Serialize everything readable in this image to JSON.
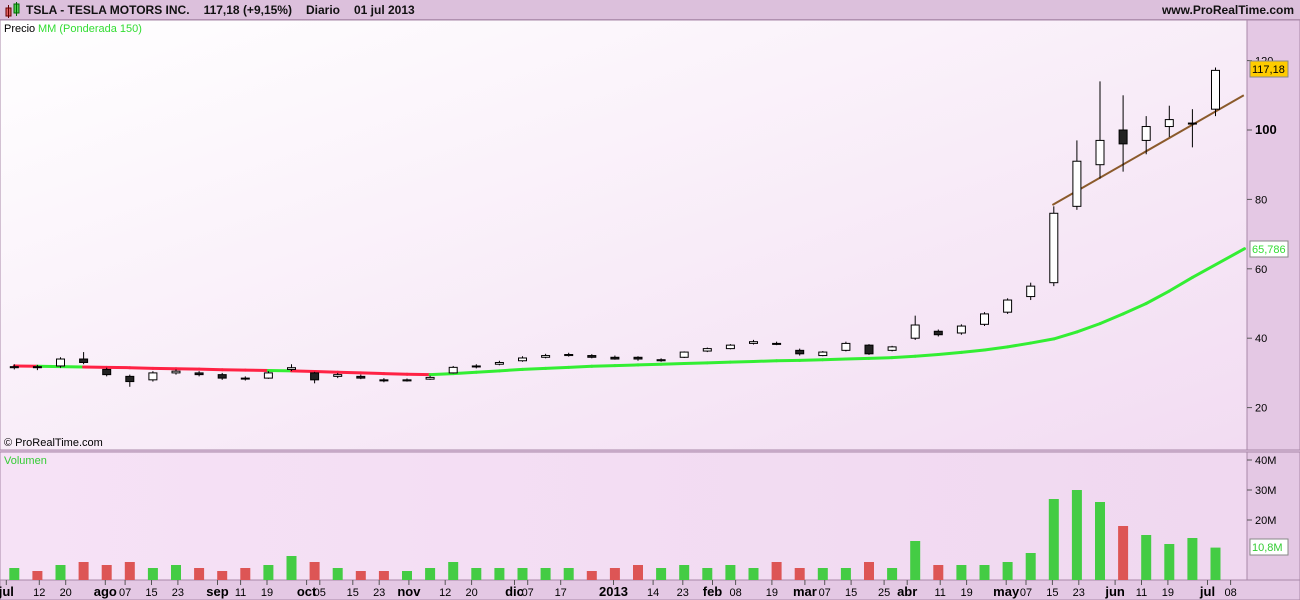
{
  "header": {
    "symbol": "TSLA - TESLA MOTORS INC.",
    "price": "117,18 (+9,15%)",
    "period": "Diario",
    "date": "01 jul 2013",
    "site": "www.ProRealTime.com"
  },
  "legend": {
    "price": "Precio",
    "ma": "MM (Ponderada 150)",
    "volume": "Volumen"
  },
  "copyright": "© ProRealTime.com",
  "colors": {
    "up": "#44cc44",
    "down": "#dd5555",
    "ma_above": "#33ee33",
    "ma_below": "#ff2244",
    "trendline": "#8b5a2b",
    "last_price_badge": "#ffcc00"
  },
  "chart_data": {
    "type": "candlestick",
    "price_axis": {
      "ticks": [
        "120",
        "100",
        "80",
        "60",
        "40",
        "20"
      ],
      "range": [
        15,
        130
      ]
    },
    "volume_axis": {
      "ticks": [
        "40M",
        "30M",
        "20M"
      ],
      "range": [
        0,
        40
      ]
    },
    "last_price": "117,18",
    "last_ma": "65,786",
    "last_volume": "10,8M",
    "x_ticks": [
      [
        "jul",
        "2012-07-02",
        1
      ],
      [
        "12",
        "2012-07-12",
        0
      ],
      [
        "20",
        "2012-07-20",
        0
      ],
      [
        "ago",
        "2012-08-01",
        1
      ],
      [
        "07",
        "2012-08-07",
        0
      ],
      [
        "15",
        "2012-08-15",
        0
      ],
      [
        "23",
        "2012-08-23",
        0
      ],
      [
        "sep",
        "2012-09-04",
        1
      ],
      [
        "11",
        "2012-09-11",
        0
      ],
      [
        "19",
        "2012-09-19",
        0
      ],
      [
        "oct",
        "2012-10-01",
        1
      ],
      [
        "05",
        "2012-10-05",
        0
      ],
      [
        "15",
        "2012-10-15",
        0
      ],
      [
        "23",
        "2012-10-23",
        0
      ],
      [
        "nov",
        "2012-11-01",
        1
      ],
      [
        "12",
        "2012-11-12",
        0
      ],
      [
        "20",
        "2012-11-20",
        0
      ],
      [
        "dic",
        "2012-12-03",
        1
      ],
      [
        "07",
        "2012-12-07",
        0
      ],
      [
        "17",
        "2012-12-17",
        0
      ],
      [
        "2013",
        "2013-01-02",
        1
      ],
      [
        "14",
        "2013-01-14",
        0
      ],
      [
        "23",
        "2013-01-23",
        0
      ],
      [
        "feb",
        "2013-02-01",
        1
      ],
      [
        "08",
        "2013-02-08",
        0
      ],
      [
        "19",
        "2013-02-19",
        0
      ],
      [
        "mar",
        "2013-03-01",
        1
      ],
      [
        "07",
        "2013-03-07",
        0
      ],
      [
        "15",
        "2013-03-15",
        0
      ],
      [
        "25",
        "2013-03-25",
        0
      ],
      [
        "abr",
        "2013-04-01",
        1
      ],
      [
        "11",
        "2013-04-11",
        0
      ],
      [
        "19",
        "2013-04-19",
        0
      ],
      [
        "may",
        "2013-05-01",
        1
      ],
      [
        "07",
        "2013-05-07",
        0
      ],
      [
        "15",
        "2013-05-15",
        0
      ],
      [
        "23",
        "2013-05-23",
        0
      ],
      [
        "jun",
        "2013-06-03",
        1
      ],
      [
        "11",
        "2013-06-11",
        0
      ],
      [
        "19",
        "2013-06-19",
        0
      ],
      [
        "jul",
        "2013-07-01",
        1
      ],
      [
        "08",
        "2013-07-08",
        0
      ]
    ],
    "candles": [
      [
        "2012-07-02",
        31.5,
        32.5,
        31,
        31.8,
        4
      ],
      [
        "2012-07-09",
        31.8,
        32.3,
        30.8,
        31.5,
        3
      ],
      [
        "2012-07-16",
        32,
        34.5,
        31.5,
        34,
        5
      ],
      [
        "2012-07-23",
        34,
        36,
        32.5,
        33,
        6
      ],
      [
        "2012-07-30",
        31,
        31.5,
        29,
        29.5,
        5
      ],
      [
        "2012-08-06",
        29,
        29.5,
        26,
        27.5,
        6
      ],
      [
        "2012-08-13",
        28,
        30.5,
        27.5,
        30,
        4
      ],
      [
        "2012-08-20",
        30,
        31,
        29.5,
        30.5,
        5
      ],
      [
        "2012-08-27",
        30,
        30.5,
        29,
        29.5,
        4
      ],
      [
        "2012-09-03",
        29.5,
        30,
        28,
        28.5,
        3
      ],
      [
        "2012-09-10",
        28.5,
        29,
        27.8,
        28.3,
        4
      ],
      [
        "2012-09-17",
        28.5,
        30.5,
        28.3,
        30,
        5
      ],
      [
        "2012-09-24",
        31,
        32.5,
        30.5,
        31.5,
        8
      ],
      [
        "2012-10-01",
        30,
        30.3,
        27,
        28,
        6
      ],
      [
        "2012-10-08",
        29,
        30,
        28.5,
        29.5,
        4
      ],
      [
        "2012-10-15",
        29,
        29.5,
        28.2,
        28.5,
        3
      ],
      [
        "2012-10-22",
        28,
        28.5,
        27.3,
        27.7,
        3
      ],
      [
        "2012-10-29",
        27.7,
        28.4,
        27.5,
        28,
        3
      ],
      [
        "2012-11-05",
        28.2,
        29.2,
        28,
        28.7,
        4
      ],
      [
        "2012-11-12",
        30,
        32,
        29.8,
        31.6,
        6
      ],
      [
        "2012-11-19",
        31.8,
        32.5,
        31.3,
        32,
        4
      ],
      [
        "2012-11-26",
        32.5,
        33.5,
        32.2,
        33,
        4
      ],
      [
        "2012-12-03",
        33.5,
        34.8,
        33.2,
        34.3,
        4
      ],
      [
        "2012-12-10",
        34.5,
        35.5,
        34.2,
        35,
        4
      ],
      [
        "2012-12-17",
        35,
        35.8,
        34.7,
        35.3,
        4
      ],
      [
        "2012-12-24",
        35,
        35.4,
        34.2,
        34.5,
        3
      ],
      [
        "2012-12-31",
        34.5,
        35,
        33.8,
        34,
        4
      ],
      [
        "2013-01-07",
        34.5,
        34.8,
        33.5,
        34,
        5
      ],
      [
        "2013-01-14",
        33.5,
        34.2,
        33.2,
        33.8,
        4
      ],
      [
        "2013-01-21",
        34.5,
        36.2,
        34.3,
        36,
        5
      ],
      [
        "2013-01-28",
        36.3,
        37.3,
        36,
        37,
        4
      ],
      [
        "2013-02-04",
        37,
        38.3,
        36.8,
        38,
        5
      ],
      [
        "2013-02-11",
        38.5,
        39.5,
        38.2,
        39,
        4
      ],
      [
        "2013-02-18",
        38.5,
        39,
        38,
        38.4,
        6
      ],
      [
        "2013-02-25",
        36.5,
        37,
        35,
        35.5,
        4
      ],
      [
        "2013-03-04",
        35,
        36.3,
        34.8,
        36,
        4
      ],
      [
        "2013-03-11",
        36.5,
        39,
        36.2,
        38.5,
        4
      ],
      [
        "2013-03-18",
        38,
        38.3,
        35.2,
        35.5,
        6
      ],
      [
        "2013-03-25",
        36.5,
        37.8,
        36.2,
        37.5,
        4
      ],
      [
        "2013-04-01",
        40,
        46.5,
        39.5,
        43.8,
        13
      ],
      [
        "2013-04-08",
        42,
        42.5,
        40.5,
        41,
        5
      ],
      [
        "2013-04-15",
        41.5,
        44,
        41,
        43.5,
        5
      ],
      [
        "2013-04-22",
        44,
        47.5,
        43.5,
        47,
        5
      ],
      [
        "2013-04-29",
        47.5,
        51.5,
        47,
        51,
        6
      ],
      [
        "2013-05-06",
        52,
        56,
        51,
        55,
        9
      ],
      [
        "2013-05-13",
        56,
        78,
        55,
        76,
        27
      ],
      [
        "2013-05-20",
        78,
        97,
        77,
        91,
        30
      ],
      [
        "2013-05-27",
        90,
        114,
        86,
        97,
        26
      ],
      [
        "2013-06-03",
        100,
        110,
        88,
        96,
        18
      ],
      [
        "2013-06-10",
        97,
        104,
        93,
        101,
        15
      ],
      [
        "2013-06-17",
        101,
        107,
        98,
        103,
        12
      ],
      [
        "2013-06-24",
        102,
        106,
        95,
        102,
        14
      ],
      [
        "2013-07-01",
        106,
        118,
        104,
        117.18,
        10.8
      ]
    ],
    "moving_average": [
      32,
      31.9,
      31.8,
      31.7,
      31.6,
      31.5,
      31.3,
      31.2,
      31.1,
      30.9,
      30.8,
      30.7,
      30.6,
      30.4,
      30.2,
      30.0,
      29.8,
      29.6,
      29.5,
      29.8,
      30.2,
      30.6,
      31.0,
      31.3,
      31.6,
      31.9,
      32.1,
      32.3,
      32.5,
      32.7,
      32.9,
      33.1,
      33.3,
      33.5,
      33.6,
      33.8,
      34.0,
      34.2,
      34.4,
      34.8,
      35.3,
      35.9,
      36.6,
      37.5,
      38.6,
      39.8,
      41.8,
      44.2,
      47.0,
      50.0,
      53.6,
      57.5,
      65.786
    ],
    "trendline": [
      [
        "2013-05-15",
        78.4
      ],
      [
        "2013-07-12",
        110
      ]
    ]
  }
}
